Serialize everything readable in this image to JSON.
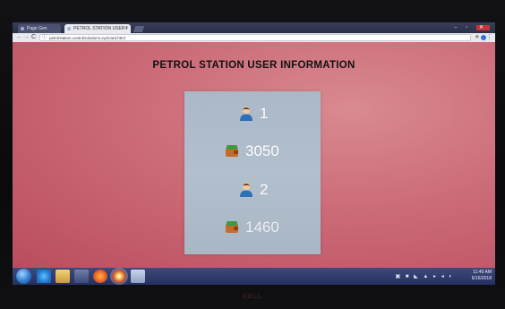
{
  "browser": {
    "tabs": [
      {
        "label": "Page Gen"
      },
      {
        "label": "PETROL STATION USER I"
      }
    ],
    "tab_close": "×",
    "window_controls": "–  ▫",
    "window_close": "✕",
    "nav": {
      "back": "←",
      "forward": "→",
      "reload": "C"
    },
    "url": "petrolstation.controlsolutions.xyz/card.html",
    "info_icon": "ⓘ",
    "star": "★",
    "menu": "⋮"
  },
  "page": {
    "title": "PETROL STATION USER INFORMATION",
    "entries": [
      {
        "icon": "user-icon",
        "value": "1"
      },
      {
        "icon": "wallet-icon",
        "value": "3050"
      },
      {
        "icon": "user-icon",
        "value": "2"
      },
      {
        "icon": "wallet-icon",
        "value": "1460"
      }
    ]
  },
  "taskbar": {
    "apps": [
      "start-orb-icon",
      "internet-explorer-icon",
      "folder-icon",
      "media-icon",
      "firefox-icon",
      "chrome-icon",
      "calculator-icon"
    ],
    "tray": "▣ ■ ◣ ▲ ▸ ◂ ◐",
    "time": "11:40 AM",
    "date": "6/16/2018"
  },
  "monitor": {
    "brand": "DELL"
  },
  "colors": {
    "page_background": "#c9636f",
    "panel": "#aeb9c7",
    "value_text": "#ffffff",
    "title_text": "#111111",
    "taskbar": "#2b3566"
  }
}
